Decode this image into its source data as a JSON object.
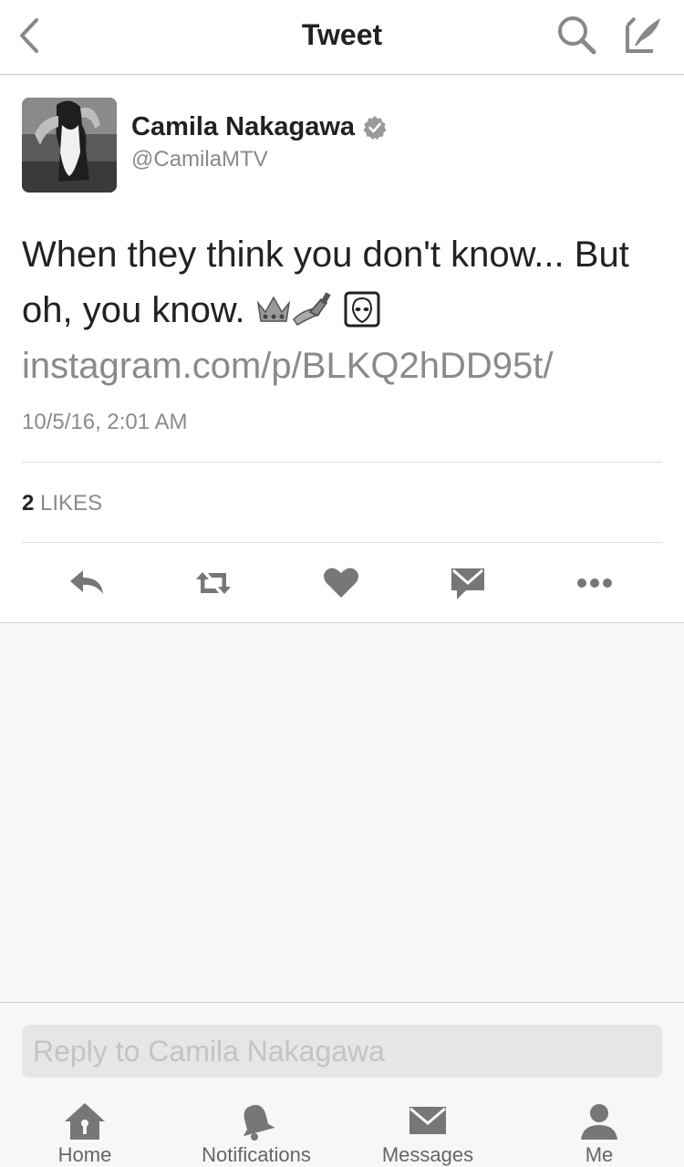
{
  "header": {
    "title": "Tweet",
    "back_icon": "chevron-left-icon",
    "search_icon": "search-icon",
    "compose_icon": "compose-icon"
  },
  "tweet": {
    "author_name": "Camila Nakagawa",
    "author_handle": "@CamilaMTV",
    "verified": true,
    "text": "When they think you don't know... But oh, you know.",
    "emojis": [
      "crown-icon",
      "nail-polish-icon",
      "alien-icon"
    ],
    "link": "instagram.com/p/BLKQ2hDD95t/",
    "timestamp": "10/5/16, 2:01 AM",
    "likes_count": "2",
    "likes_label": "LIKES"
  },
  "actions": [
    "reply-icon",
    "retweet-icon",
    "like-icon",
    "direct-message-icon",
    "more-icon"
  ],
  "reply": {
    "placeholder": "Reply to Camila Nakagawa"
  },
  "tabbar": {
    "items": [
      {
        "label": "Home",
        "icon": "home-icon"
      },
      {
        "label": "Notifications",
        "icon": "bell-icon"
      },
      {
        "label": "Messages",
        "icon": "envelope-icon"
      },
      {
        "label": "Me",
        "icon": "person-icon"
      }
    ]
  },
  "colors": {
    "text": "#222222",
    "muted": "#8a8a8a",
    "icon": "#777777",
    "background": "#f7f7f7"
  }
}
